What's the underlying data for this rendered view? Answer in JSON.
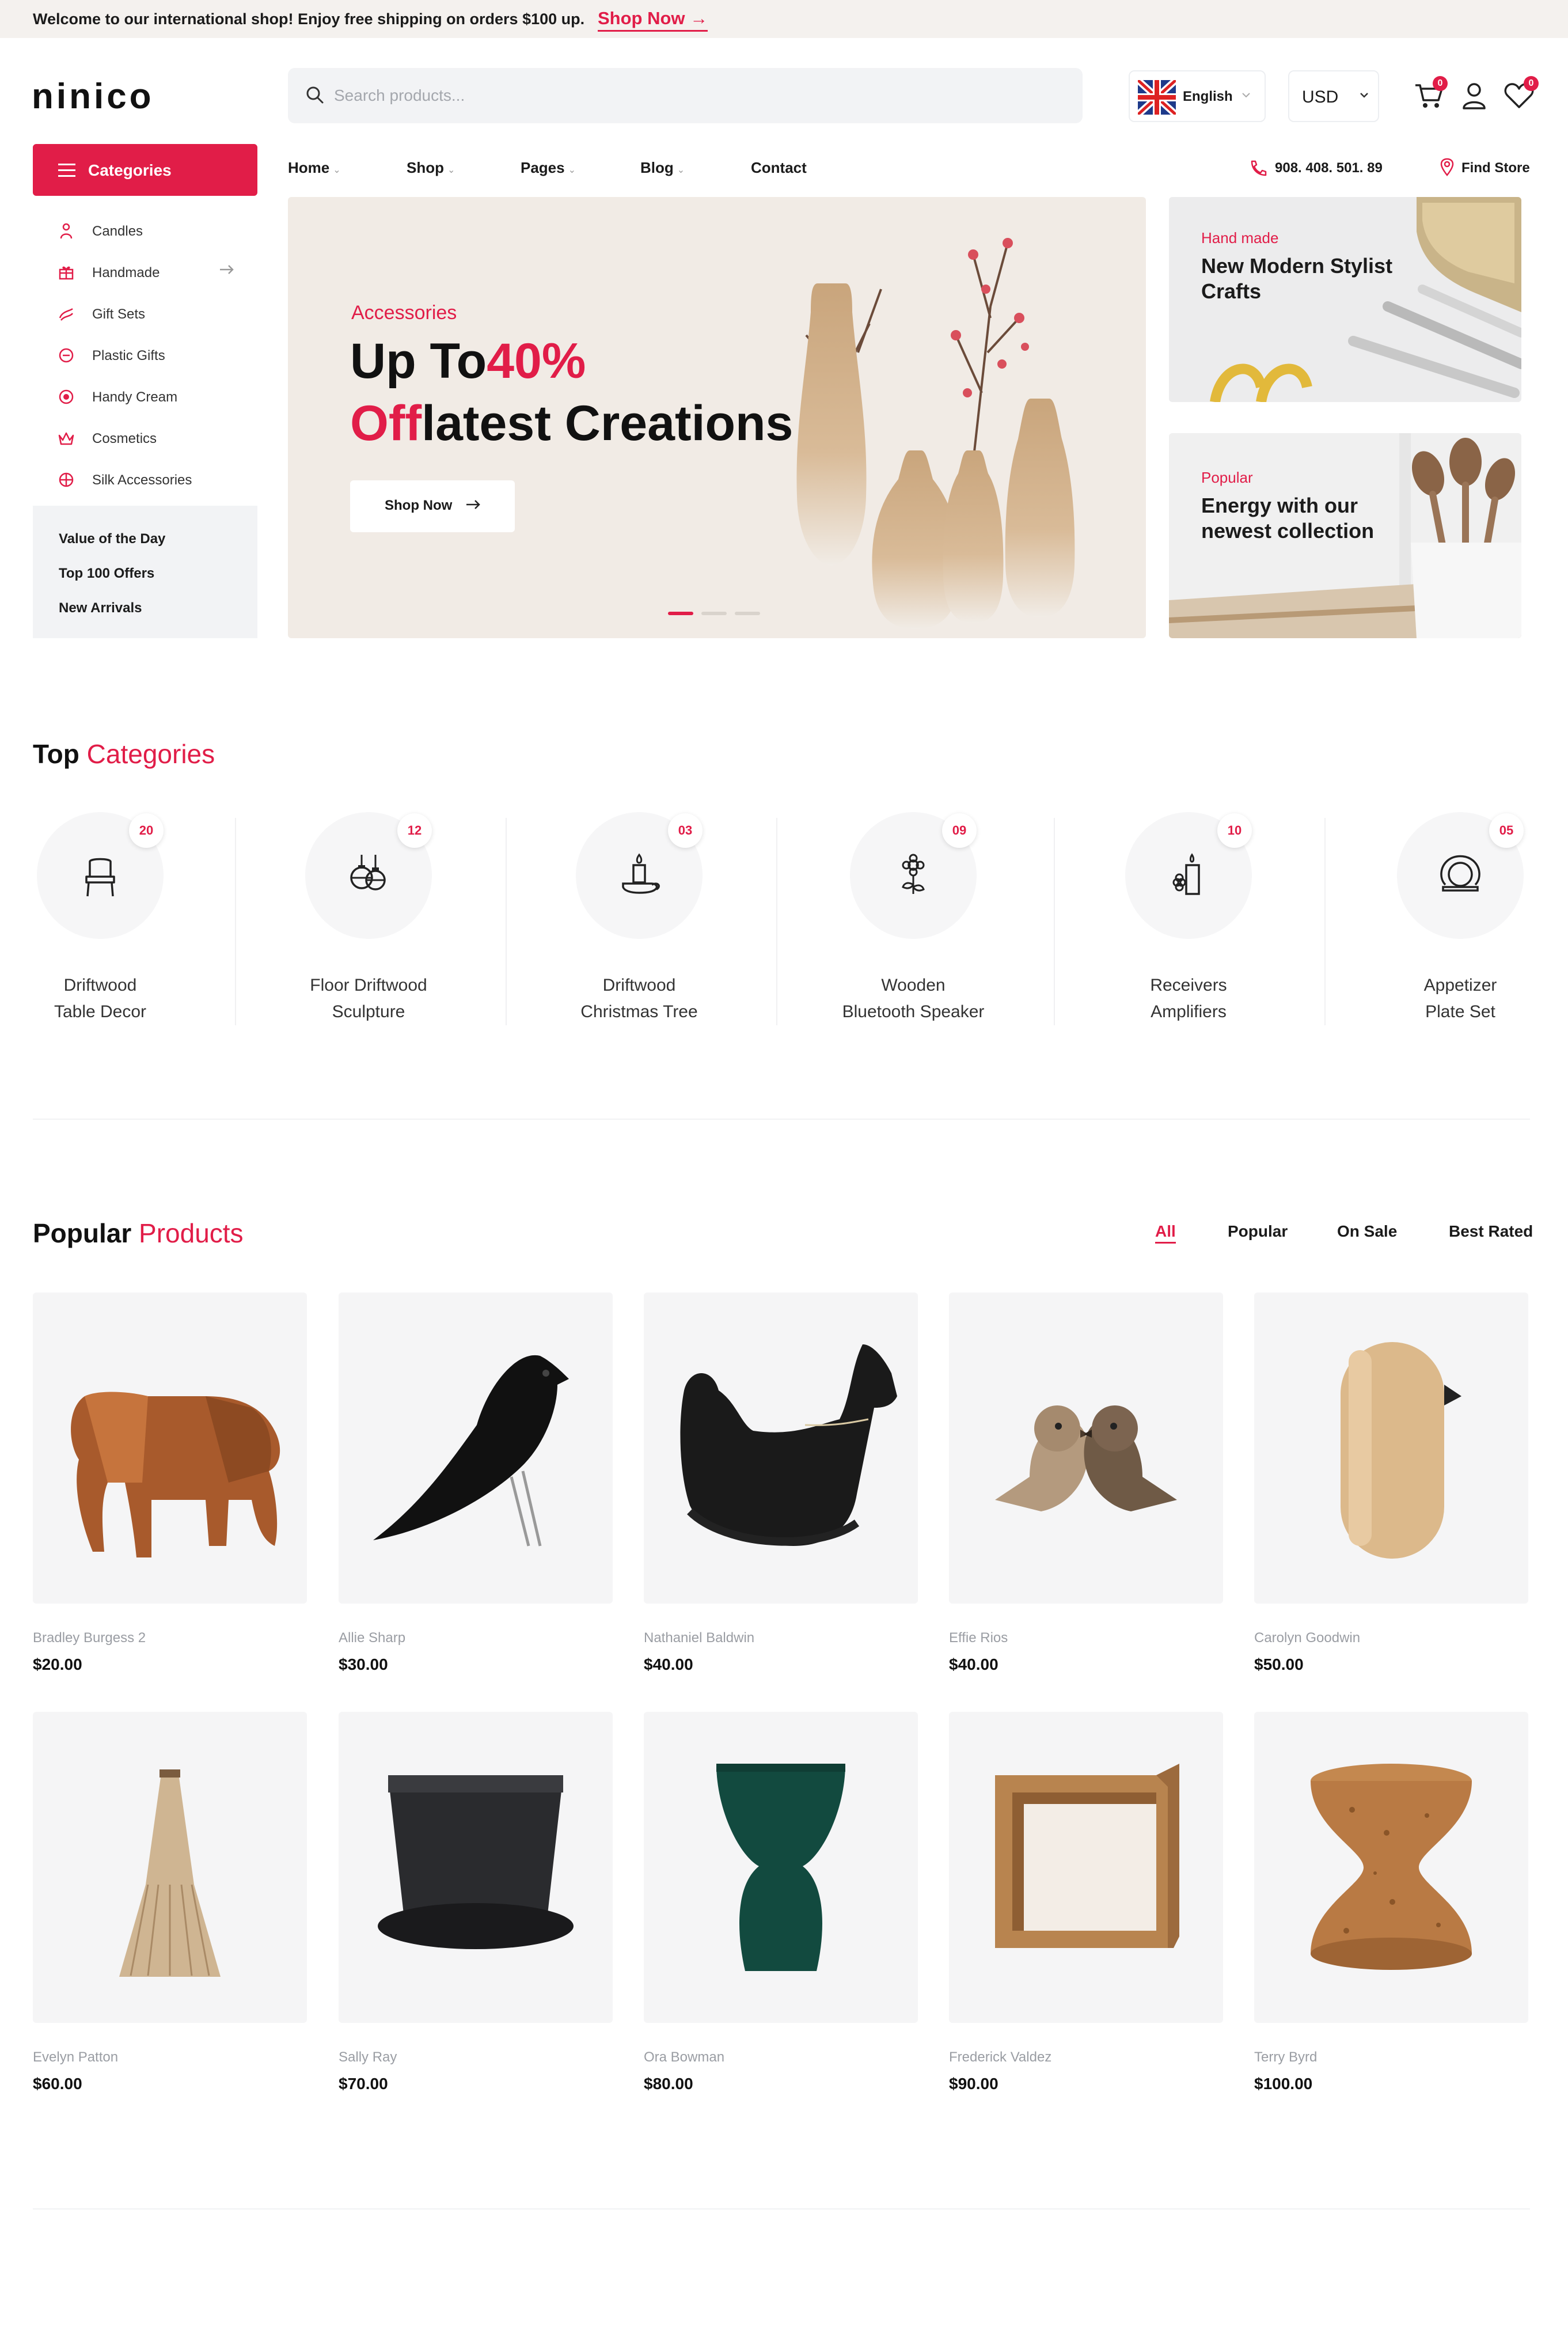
{
  "topbar": {
    "message": "Welcome to our international shop! Enjoy free shipping on orders $100 up.",
    "shop_now": "Shop Now →"
  },
  "header": {
    "logo": "ninico",
    "search_placeholder": "Search products...",
    "language": "English",
    "currency": "USD",
    "cart_count": "0",
    "wishlist_count": "0"
  },
  "categories": {
    "button_label": "Categories",
    "items": [
      {
        "label": "Candles",
        "icon": "candle-icon"
      },
      {
        "label": "Handmade",
        "icon": "gift-icon"
      },
      {
        "label": "Gift Sets",
        "icon": "gift-set-icon"
      },
      {
        "label": "Plastic Gifts",
        "icon": "plastic-gift-icon"
      },
      {
        "label": "Handy Cream",
        "icon": "cream-icon"
      },
      {
        "label": "Cosmetics",
        "icon": "crown-icon"
      },
      {
        "label": "Silk Accessories",
        "icon": "silk-icon"
      }
    ],
    "extras": [
      "Value of the Day",
      "Top 100 Offers",
      "New Arrivals"
    ]
  },
  "nav": {
    "items": [
      "Home",
      "Shop",
      "Pages",
      "Blog",
      "Contact"
    ],
    "phone": "908. 408. 501. 89",
    "find_store": "Find Store"
  },
  "hero": {
    "eyebrow": "Accessories",
    "line1_a": "Up To",
    "line1_b": "40%",
    "line2_a": "Off",
    "line2_b": "latest Creations",
    "button": "Shop Now",
    "slides_total": 3,
    "active_slide": 1
  },
  "promos": [
    {
      "eyebrow": "Hand made",
      "title": "New Modern Stylist Crafts"
    },
    {
      "eyebrow": "Popular",
      "title": "Energy with our newest collection"
    }
  ],
  "top_categories": {
    "title_a": "Top",
    "title_b": "Categories",
    "items": [
      {
        "line1": "Driftwood",
        "line2": "Table Decor",
        "count": "20",
        "icon": "chair-icon"
      },
      {
        "line1": "Floor Driftwood",
        "line2": "Sculpture",
        "count": "12",
        "icon": "ornament-icon"
      },
      {
        "line1": "Driftwood",
        "line2": "Christmas Tree",
        "count": "03",
        "icon": "candle-holder-icon"
      },
      {
        "line1": "Wooden",
        "line2": "Bluetooth Speaker",
        "count": "09",
        "icon": "flower-icon"
      },
      {
        "line1": "Receivers",
        "line2": "Amplifiers",
        "count": "10",
        "icon": "candle-flower-icon"
      },
      {
        "line1": "Appetizer",
        "line2": "Plate Set",
        "count": "05",
        "icon": "plate-icon"
      }
    ]
  },
  "popular": {
    "title_a": "Popular",
    "title_b": "Products",
    "filters": [
      "All",
      "Popular",
      "On Sale",
      "Best Rated"
    ],
    "active_filter": "All",
    "products": [
      {
        "name": "Bradley Burgess 2",
        "price": "$20.00",
        "image": "wooden-elephant"
      },
      {
        "name": "Allie Sharp",
        "price": "$30.00",
        "image": "black-bird"
      },
      {
        "name": "Nathaniel Baldwin",
        "price": "$40.00",
        "image": "rocking-horse"
      },
      {
        "name": "Effie Rios",
        "price": "$40.00",
        "image": "wooden-birds"
      },
      {
        "name": "Carolyn Goodwin",
        "price": "$50.00",
        "image": "wooden-bird-oval"
      },
      {
        "name": "Evelyn Patton",
        "price": "$60.00",
        "image": "pendant-lamp"
      },
      {
        "name": "Sally Ray",
        "price": "$70.00",
        "image": "black-pot"
      },
      {
        "name": "Ora Bowman",
        "price": "$80.00",
        "image": "green-vase"
      },
      {
        "name": "Frederick Valdez",
        "price": "$90.00",
        "image": "wooden-cube"
      },
      {
        "name": "Terry Byrd",
        "price": "$100.00",
        "image": "cork-stool"
      }
    ]
  },
  "colors": {
    "accent": "#e11d48",
    "topbar_bg": "#f4f1ee",
    "hero_bg": "#f1ebe5"
  }
}
